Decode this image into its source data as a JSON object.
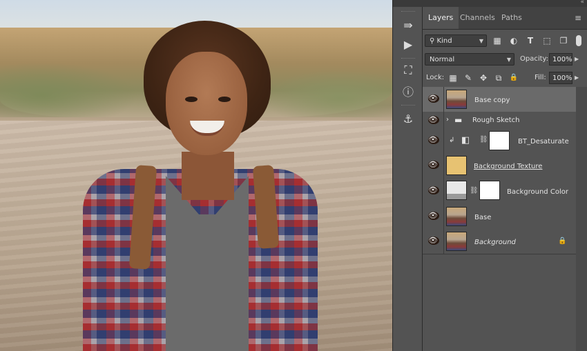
{
  "colors": {
    "panel_bg": "#535353",
    "tab_bg": "#424242",
    "selected_row": "#6a6a6a",
    "accent_thumb_yellow": "#e7c272"
  },
  "tool_strip": {
    "tools": [
      {
        "name": "history-brush-icon",
        "glyph": "⇛"
      },
      {
        "name": "play-action-icon",
        "glyph": "▶"
      },
      {
        "name": "3d-cube-icon",
        "glyph": "⛶"
      },
      {
        "name": "info-icon",
        "glyph": "ⓘ"
      },
      {
        "name": "clone-source-icon",
        "glyph": "⚓"
      }
    ]
  },
  "panel": {
    "tabs": [
      {
        "label": "Layers",
        "active": true
      },
      {
        "label": "Channels",
        "active": false
      },
      {
        "label": "Paths",
        "active": false
      }
    ],
    "filter": {
      "kind_label": "Kind",
      "search_glyph": "⚲"
    },
    "filter_icons": [
      {
        "name": "image-filter-icon",
        "glyph": "▦"
      },
      {
        "name": "adjustment-filter-icon",
        "glyph": "◐"
      },
      {
        "name": "type-filter-icon",
        "glyph": "T"
      },
      {
        "name": "shape-filter-icon",
        "glyph": "⬚"
      },
      {
        "name": "smart-object-filter-icon",
        "glyph": "❐"
      }
    ],
    "blend_mode": "Normal",
    "opacity_label": "Opacity:",
    "opacity_value": "100%",
    "lock_label": "Lock:",
    "lock_icons": [
      {
        "name": "lock-transparent-icon",
        "glyph": "▦"
      },
      {
        "name": "lock-image-icon",
        "glyph": "✎"
      },
      {
        "name": "lock-position-icon",
        "glyph": "✥"
      },
      {
        "name": "lock-artboard-icon",
        "glyph": "⧉"
      },
      {
        "name": "lock-all-icon",
        "glyph": "🔒"
      }
    ],
    "fill_label": "Fill:",
    "fill_value": "100%",
    "layers": [
      {
        "name": "Base copy",
        "thumb": "photo",
        "selected": true
      },
      {
        "name": "Rough Sketch",
        "group": true
      },
      {
        "name": "BT_Desaturate",
        "adjustment": true
      },
      {
        "name": "Background Texture",
        "thumb": "yellow"
      },
      {
        "name": "Background Color",
        "thumb": "gray"
      },
      {
        "name": "Base",
        "thumb": "photo"
      },
      {
        "name": "Background",
        "thumb": "photo",
        "locked": true
      }
    ]
  }
}
